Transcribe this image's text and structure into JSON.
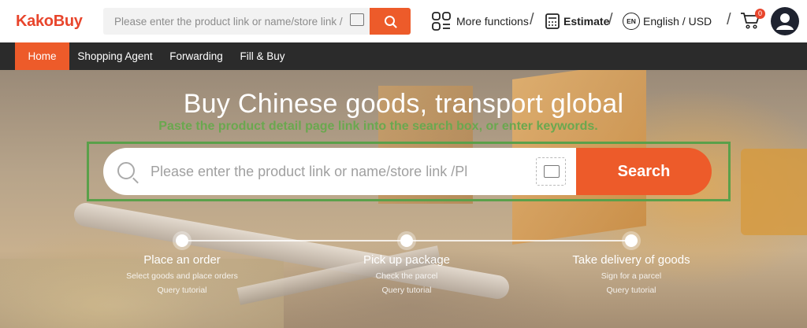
{
  "brand": {
    "name": "KakoBuy"
  },
  "header": {
    "search_placeholder": "Please enter the product link or name/store link /Pl",
    "more_functions": "More functions",
    "estimate": "Estimate",
    "lang_code": "EN",
    "language_currency": "English / USD",
    "cart_count": "0",
    "separator": "/"
  },
  "nav": {
    "items": [
      {
        "label": "Home"
      },
      {
        "label": "Shopping Agent"
      },
      {
        "label": "Forwarding"
      },
      {
        "label": "Fill & Buy"
      }
    ]
  },
  "hero": {
    "title": "Buy Chinese goods, transport global",
    "subtitle": "Paste the product detail page link into the search box, or enter keywords.",
    "search_placeholder": "Please enter the product link or name/store link /Pl",
    "search_button": "Search"
  },
  "steps": [
    {
      "title": "Place an order",
      "subtitle": "Select goods and place orders",
      "link": "Query tutorial"
    },
    {
      "title": "Pick up package",
      "subtitle": "Check the parcel",
      "link": "Query tutorial"
    },
    {
      "title": "Take delivery of goods",
      "subtitle": "Sign for a parcel",
      "link": "Query tutorial"
    }
  ],
  "colors": {
    "accent": "#ed5b2a",
    "nav_bg": "#2b2b2b",
    "highlight": "#5aa04a"
  }
}
